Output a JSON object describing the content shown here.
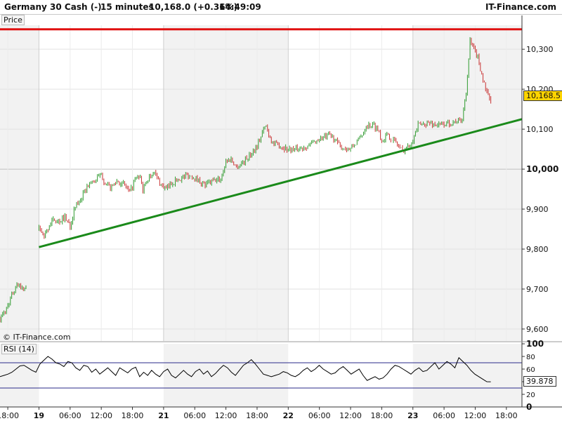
{
  "header": {
    "instrument": "Germany 30 Cash (-)",
    "timeframe": "15 minutes",
    "quote": "10,168.0 (+0.36%)",
    "time": "14:49:09",
    "brand": "IT-Finance.com"
  },
  "price_panel": {
    "label": "Price",
    "watermark": "© IT-Finance.com",
    "last_price_label": "10,168.5"
  },
  "rsi_panel": {
    "label": "RSI (14)",
    "last_value_label": "39.878"
  },
  "colors": {
    "up_candle": "#2e9a2e",
    "down_candle": "#c83232",
    "trendline": "#1a8a1a",
    "resistance": "#e01010",
    "rsi_line": "#000000",
    "rsi_levels": "#2a2a8a"
  },
  "chart_data": [
    {
      "type": "candlestick",
      "title": "Germany 30 Cash (-)",
      "ylim": [
        9570,
        10360
      ],
      "y_ticks": [
        9600,
        9700,
        9800,
        9900,
        10000,
        10100,
        10200,
        10300
      ],
      "y_tick_labels": [
        "9,600",
        "9,700",
        "9,800",
        "9,900",
        "10,000",
        "10,100",
        "10,200",
        "10,300"
      ],
      "x_ticks": [
        "18:00",
        "19",
        "06:00",
        "12:00",
        "18:00",
        "21",
        "06:00",
        "12:00",
        "18:00",
        "22",
        "06:00",
        "12:00",
        "18:00",
        "23",
        "06:00",
        "12:00",
        "18:00"
      ],
      "x_tick_hours": [
        -6,
        0,
        6,
        12,
        18,
        24,
        30,
        36,
        42,
        48,
        54,
        60,
        66,
        72,
        78,
        84,
        90
      ],
      "x_range_hours": [
        -7.5,
        93
      ],
      "day_breaks_hours": [
        0,
        24,
        48,
        72
      ],
      "close_path": [
        [
          -7.5,
          9625
        ],
        [
          -6.5,
          9645
        ],
        [
          -5.5,
          9675
        ],
        [
          -4.5,
          9705
        ],
        [
          -3.8,
          9715
        ],
        [
          -3.2,
          9700
        ],
        [
          -2.5,
          9705
        ],
        [
          0,
          9850
        ],
        [
          1.0,
          9830
        ],
        [
          2.0,
          9860
        ],
        [
          3.0,
          9875
        ],
        [
          4.0,
          9870
        ],
        [
          5.0,
          9880
        ],
        [
          6.0,
          9860
        ],
        [
          7.0,
          9905
        ],
        [
          8.0,
          9925
        ],
        [
          9.5,
          9960
        ],
        [
          11.0,
          9975
        ],
        [
          12.0,
          9985
        ],
        [
          13.0,
          9960
        ],
        [
          14.0,
          9955
        ],
        [
          15.0,
          9970
        ],
        [
          16.5,
          9960
        ],
        [
          17.5,
          9940
        ],
        [
          18.5,
          9975
        ],
        [
          19.5,
          9980
        ],
        [
          20.0,
          9945
        ],
        [
          21.0,
          9975
        ],
        [
          22.0,
          9995
        ],
        [
          23.5,
          9960
        ],
        [
          24.5,
          9950
        ],
        [
          25.5,
          9965
        ],
        [
          27.0,
          9975
        ],
        [
          28.5,
          9985
        ],
        [
          30.0,
          9980
        ],
        [
          31.0,
          9970
        ],
        [
          32.0,
          9960
        ],
        [
          33.5,
          9970
        ],
        [
          35.0,
          9975
        ],
        [
          36.0,
          10020
        ],
        [
          37.0,
          10025
        ],
        [
          38.0,
          10005
        ],
        [
          39.5,
          10020
        ],
        [
          41.0,
          10040
        ],
        [
          42.0,
          10060
        ],
        [
          43.0,
          10090
        ],
        [
          43.7,
          10110
        ],
        [
          44.2,
          10090
        ],
        [
          45.0,
          10065
        ],
        [
          46.0,
          10060
        ],
        [
          48.0,
          10050
        ],
        [
          50.0,
          10050
        ],
        [
          52.0,
          10060
        ],
        [
          54.0,
          10075
        ],
        [
          55.0,
          10080
        ],
        [
          56.0,
          10085
        ],
        [
          57.0,
          10075
        ],
        [
          58.0,
          10055
        ],
        [
          60.0,
          10050
        ],
        [
          61.0,
          10065
        ],
        [
          62.0,
          10080
        ],
        [
          63.0,
          10110
        ],
        [
          64.5,
          10110
        ],
        [
          65.5,
          10095
        ],
        [
          66.0,
          10070
        ],
        [
          67.0,
          10085
        ],
        [
          68.5,
          10070
        ],
        [
          70.0,
          10045
        ],
        [
          71.0,
          10055
        ],
        [
          72.0,
          10075
        ],
        [
          73.0,
          10110
        ],
        [
          75.0,
          10115
        ],
        [
          77.0,
          10110
        ],
        [
          79.0,
          10115
        ],
        [
          80.5,
          10120
        ],
        [
          81.5,
          10125
        ],
        [
          82.3,
          10200
        ],
        [
          83.0,
          10320
        ],
        [
          83.7,
          10300
        ],
        [
          84.5,
          10280
        ],
        [
          85.2,
          10240
        ],
        [
          85.8,
          10210
        ],
        [
          86.5,
          10180
        ],
        [
          87.0,
          10168.5
        ]
      ],
      "annotations": [
        {
          "type": "trendline",
          "from": [
            0,
            9805
          ],
          "to": [
            93,
            10125
          ]
        },
        {
          "type": "horizontal_line",
          "value": 10350,
          "label": ""
        }
      ],
      "last_price": 10168.5,
      "grid": true
    },
    {
      "type": "line",
      "title": "RSI (14)",
      "ylim": [
        0,
        100
      ],
      "y_ticks": [
        0,
        20,
        40,
        60,
        80,
        100
      ],
      "levels": [
        30,
        70
      ],
      "values": [
        48,
        50,
        52,
        55,
        60,
        65,
        66,
        62,
        58,
        55,
        68,
        74,
        80,
        76,
        70,
        68,
        64,
        72,
        70,
        62,
        58,
        66,
        64,
        55,
        60,
        52,
        57,
        62,
        56,
        50,
        62,
        58,
        54,
        60,
        63,
        48,
        55,
        50,
        58,
        52,
        48,
        56,
        60,
        50,
        46,
        52,
        58,
        52,
        48,
        56,
        60,
        52,
        57,
        48,
        53,
        60,
        66,
        62,
        55,
        50,
        58,
        66,
        70,
        75,
        68,
        60,
        52,
        50,
        48,
        50,
        52,
        56,
        54,
        50,
        48,
        52,
        58,
        62,
        56,
        60,
        66,
        60,
        56,
        52,
        54,
        60,
        64,
        58,
        52,
        56,
        60,
        50,
        42,
        45,
        48,
        44,
        46,
        52,
        60,
        66,
        64,
        60,
        56,
        52,
        58,
        62,
        56,
        58,
        64,
        70,
        60,
        66,
        72,
        68,
        62,
        78,
        72,
        66,
        58,
        52,
        48,
        44,
        40,
        39.878
      ],
      "last_value": 39.878
    }
  ]
}
